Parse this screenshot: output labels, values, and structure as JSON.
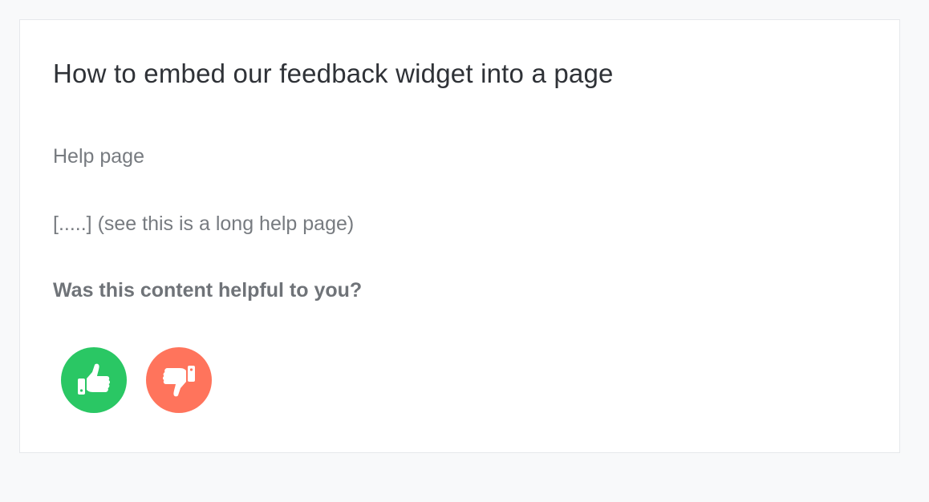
{
  "article": {
    "title": "How to embed our feedback widget into a page",
    "paragraphs": [
      "Help page",
      "[.....] (see this is a long help page)"
    ]
  },
  "feedback": {
    "question": "Was this content helpful to you?",
    "buttons": [
      {
        "name": "thumbs-up",
        "icon": "thumbs-up-icon",
        "color": "#2ac764"
      },
      {
        "name": "thumbs-down",
        "icon": "thumbs-down-icon",
        "color": "#ff745c"
      }
    ]
  },
  "colors": {
    "background": "#f8f9fa",
    "card": "#ffffff",
    "title_text": "#2f3237",
    "body_text": "#777b80"
  }
}
